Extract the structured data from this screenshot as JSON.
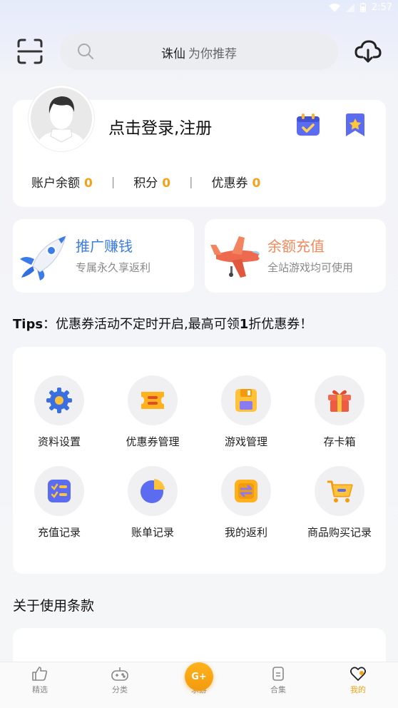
{
  "status_bar": {
    "time": "2:57"
  },
  "search": {
    "keyword": "诛仙",
    "hint": "为你推荐"
  },
  "profile": {
    "login_text": "点击登录,注册",
    "balance_label": "账户余额",
    "balance_value": "0",
    "points_label": "积分",
    "points_value": "0",
    "coupon_label": "优惠券",
    "coupon_value": "0"
  },
  "promos": [
    {
      "title": "推广赚钱",
      "subtitle": "专属永久享返利",
      "color": "#3b7ce8"
    },
    {
      "title": "余额充值",
      "subtitle": "全站游戏均可使用",
      "color": "#f08a5c"
    }
  ],
  "tips": {
    "prefix": "Tips",
    "text_before": "：优惠券活动不定时开启,最高可领",
    "bold": "1",
    "text_after": "折优惠券！"
  },
  "grid": [
    {
      "label": "资料设置",
      "icon": "gear-icon"
    },
    {
      "label": "优惠券管理",
      "icon": "ticket-icon"
    },
    {
      "label": "游戏管理",
      "icon": "save-icon"
    },
    {
      "label": "存卡箱",
      "icon": "gift-icon"
    },
    {
      "label": "充值记录",
      "icon": "checklist-icon"
    },
    {
      "label": "账单记录",
      "icon": "pie-icon"
    },
    {
      "label": "我的返利",
      "icon": "exchange-icon"
    },
    {
      "label": "商品购买记录",
      "icon": "cart-icon"
    }
  ],
  "section": {
    "title": "关于使用条款"
  },
  "tabbar": {
    "items": [
      {
        "label": "精选",
        "icon": "thumbs-up-icon"
      },
      {
        "label": "分类",
        "icon": "gamepad-icon"
      },
      {
        "label": "求游",
        "icon": "request-icon",
        "badge": "G+"
      },
      {
        "label": "合集",
        "icon": "collection-icon"
      },
      {
        "label": "我的",
        "icon": "heart-icon"
      }
    ],
    "active_index": 4,
    "accent": "#f2a41a"
  }
}
